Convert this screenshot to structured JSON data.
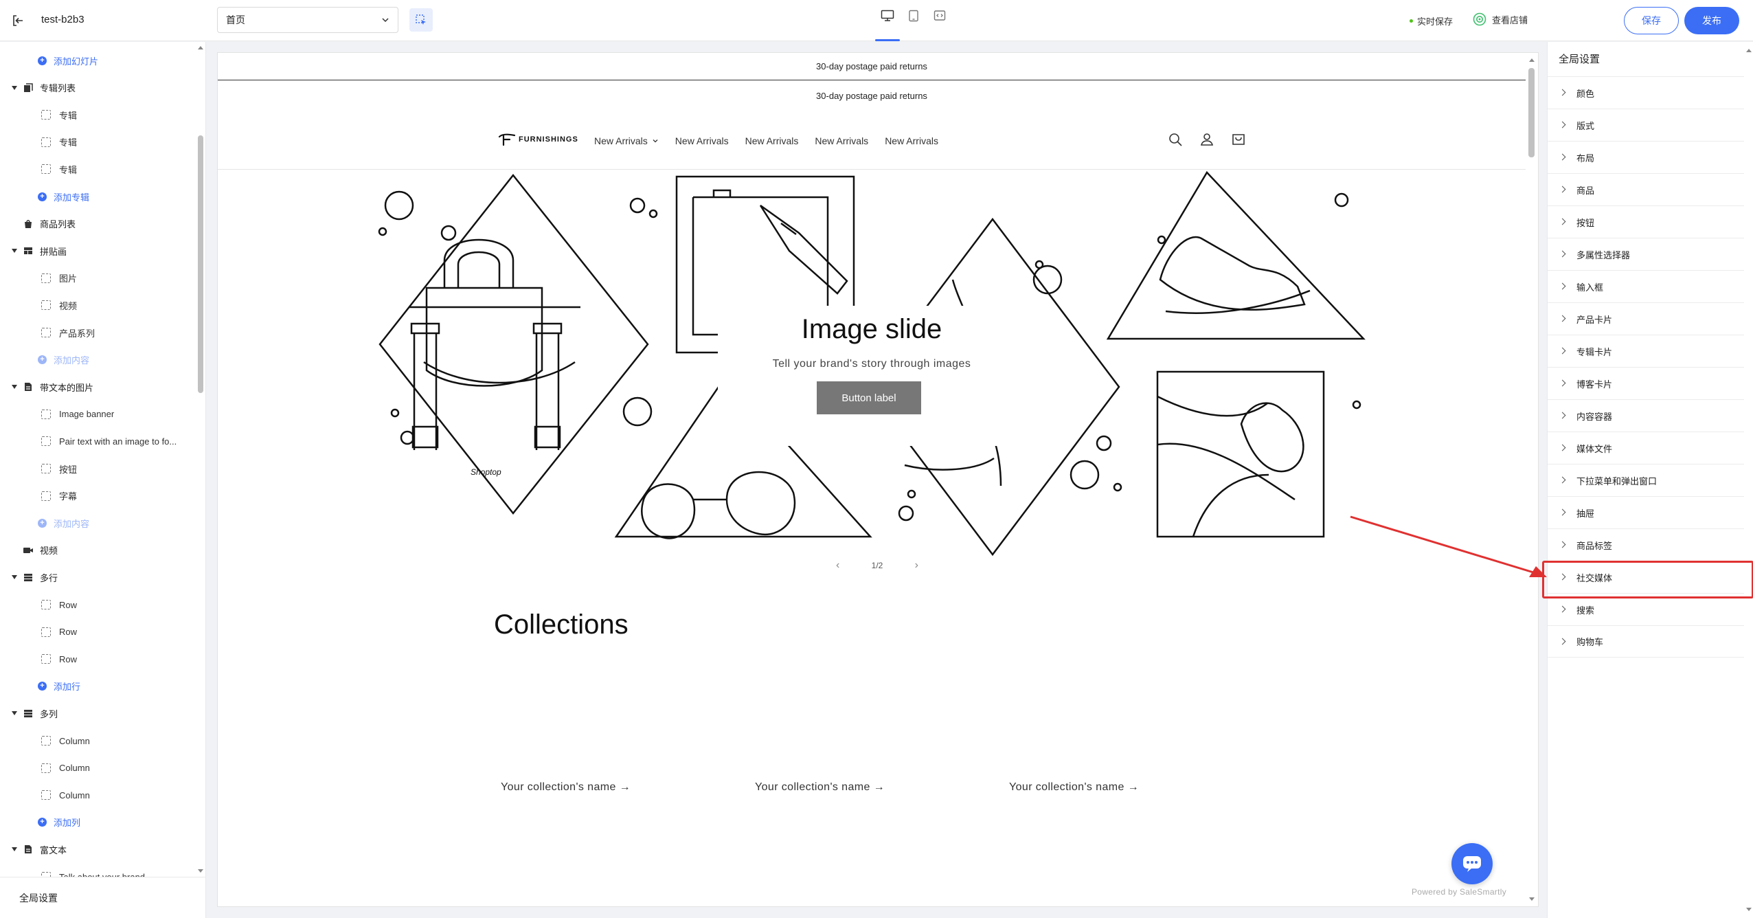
{
  "topbar": {
    "store_name": "test-b2b3",
    "page_select_value": "首页",
    "autosave_label": "实时保存",
    "view_store_label": "查看店铺",
    "save_label": "保存",
    "publish_label": "发布",
    "accent_color": "#3b6ef5"
  },
  "sidebar": {
    "items": [
      {
        "kind": "add",
        "label": "添加幻灯片"
      },
      {
        "kind": "section",
        "label": "专辑列表",
        "icon": "collection-icon"
      },
      {
        "kind": "child",
        "label": "专辑"
      },
      {
        "kind": "child",
        "label": "专辑"
      },
      {
        "kind": "child",
        "label": "专辑"
      },
      {
        "kind": "add",
        "label": "添加专辑"
      },
      {
        "kind": "section",
        "label": "商品列表",
        "icon": "product-icon",
        "nocaret": true
      },
      {
        "kind": "section",
        "label": "拼贴画",
        "icon": "collage-icon"
      },
      {
        "kind": "child",
        "label": "图片"
      },
      {
        "kind": "child",
        "label": "视频"
      },
      {
        "kind": "child",
        "label": "产品系列"
      },
      {
        "kind": "add",
        "label": "添加内容",
        "faded": true
      },
      {
        "kind": "section",
        "label": "带文本的图片",
        "icon": "document-icon"
      },
      {
        "kind": "child",
        "label": "Image banner"
      },
      {
        "kind": "child",
        "label": "Pair text with an image to fo..."
      },
      {
        "kind": "child",
        "label": "按钮"
      },
      {
        "kind": "child",
        "label": "字幕"
      },
      {
        "kind": "add",
        "label": "添加内容",
        "faded": true
      },
      {
        "kind": "section",
        "label": "视频",
        "icon": "video-icon",
        "nocaret": true
      },
      {
        "kind": "section",
        "label": "多行",
        "icon": "stack-icon"
      },
      {
        "kind": "child",
        "label": "Row"
      },
      {
        "kind": "child",
        "label": "Row"
      },
      {
        "kind": "child",
        "label": "Row"
      },
      {
        "kind": "add",
        "label": "添加行"
      },
      {
        "kind": "section",
        "label": "多列",
        "icon": "stack-icon"
      },
      {
        "kind": "child",
        "label": "Column"
      },
      {
        "kind": "child",
        "label": "Column"
      },
      {
        "kind": "child",
        "label": "Column"
      },
      {
        "kind": "add",
        "label": "添加列"
      },
      {
        "kind": "section",
        "label": "富文本",
        "icon": "document-icon"
      },
      {
        "kind": "child",
        "label": "Talk about your brand"
      }
    ],
    "footer_label": "全局设置"
  },
  "preview": {
    "announcement_1": "30-day postage paid returns",
    "announcement_2": "30-day postage paid returns",
    "logo_text": "FURNISHINGS",
    "nav": [
      "New Arrivals",
      "New Arrivals",
      "New Arrivals",
      "New Arrivals",
      "New Arrivals"
    ],
    "hero_title": "Image slide",
    "hero_subtitle": "Tell your brand's story through images",
    "hero_button": "Button label",
    "bag_label": "Shoptop",
    "slide_counter": "1/2",
    "collections_title": "Collections",
    "collection_names": [
      "Your collection's name →",
      "Your collection's name →",
      "Your collection's name →"
    ],
    "powered_by": "Powered by SaleSmartly"
  },
  "right_panel": {
    "title": "全局设置",
    "items": [
      "颜色",
      "版式",
      "布局",
      "商品",
      "按钮",
      "多属性选择器",
      "输入框",
      "产品卡片",
      "专辑卡片",
      "博客卡片",
      "内容容器",
      "媒体文件",
      "下拉菜单和弹出窗口",
      "抽屉",
      "商品标签",
      "社交媒体",
      "搜索",
      "购物车"
    ],
    "highlighted_item": "社交媒体"
  }
}
